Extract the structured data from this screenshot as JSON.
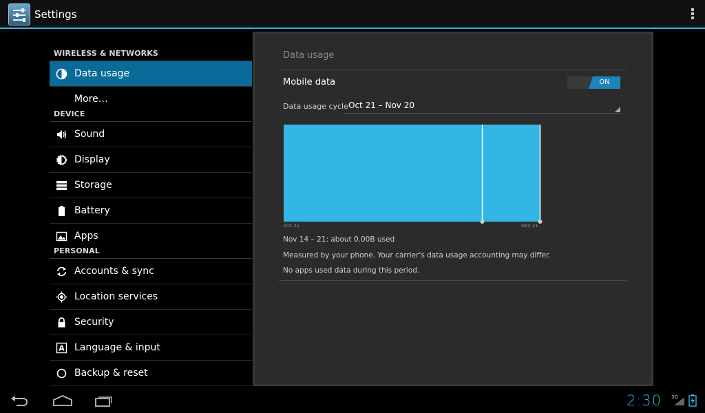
{
  "actionbar": {
    "title": "Settings",
    "overflow_icon": "overflow-menu-icon"
  },
  "sections": [
    {
      "header": "WIRELESS & NETWORKS",
      "items": [
        {
          "label": "Data usage",
          "icon": "data-usage-icon",
          "selected": true
        },
        {
          "label": "More…",
          "icon": "",
          "selected": false
        }
      ]
    },
    {
      "header": "DEVICE",
      "items": [
        {
          "label": "Sound",
          "icon": "sound-icon"
        },
        {
          "label": "Display",
          "icon": "display-icon"
        },
        {
          "label": "Storage",
          "icon": "storage-icon"
        },
        {
          "label": "Battery",
          "icon": "battery-icon"
        },
        {
          "label": "Apps",
          "icon": "apps-icon"
        }
      ]
    },
    {
      "header": "PERSONAL",
      "items": [
        {
          "label": "Accounts & sync",
          "icon": "sync-icon"
        },
        {
          "label": "Location services",
          "icon": "location-icon"
        },
        {
          "label": "Security",
          "icon": "lock-icon"
        },
        {
          "label": "Language & input",
          "icon": "language-icon"
        },
        {
          "label": "Backup & reset",
          "icon": "backup-icon"
        }
      ]
    }
  ],
  "detail": {
    "title": "Data usage",
    "mobile_data_label": "Mobile data",
    "toggle_state": "ON",
    "cycle_label": "Data usage cycle",
    "cycle_value": "Oct 21 – Nov 20",
    "chart_start_label": "Oct 21",
    "chart_end_label": "Nov 21",
    "summary": "Nov 14 – 21: about 0.00B used",
    "measured_note": "Measured by your phone. Your carrier's data usage accounting may differ.",
    "no_apps": "No apps used data during this period."
  },
  "status": {
    "clock": "2:30",
    "network": "3G"
  },
  "colors": {
    "accent": "#33b5e5",
    "selected": "#0a6b98",
    "chart_fill": "#33b5e5"
  }
}
